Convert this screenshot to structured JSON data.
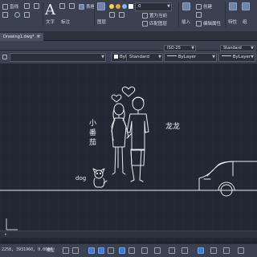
{
  "ribbon": {
    "text_label": "文字",
    "annotation_label": "标注",
    "layer_label": "图层",
    "properties_label": "特性",
    "layer_match_label": "匹配图层",
    "insert_label": "插入",
    "edit_attr_label": "编辑属性",
    "create_label": "创建",
    "line_label": "直线",
    "table_label": "表格",
    "layer_value": "0",
    "set_current_label": "置为当前",
    "match_label": "特性",
    "group_label": "组"
  },
  "tab": {
    "title": "Drawing1.dwg*",
    "close_glyph": "×",
    "add_glyph": "+"
  },
  "properties": {
    "text_style": "Standard",
    "dim_style": "ISO-25",
    "table_style": "Standard",
    "layer": "ByLayer",
    "linetype": "ByLayer",
    "lineweight": "ByLayer",
    "colors": {
      "accent": "#3d7bd6",
      "background": "#212733",
      "line": "#e8ebf0"
    }
  },
  "drawing": {
    "girl_label": "小番茄",
    "boy_label": "龙龙",
    "dog_label": "dog"
  },
  "status": {
    "coordinates": "2258, 3931960, 0.0000",
    "mode": "模型"
  }
}
